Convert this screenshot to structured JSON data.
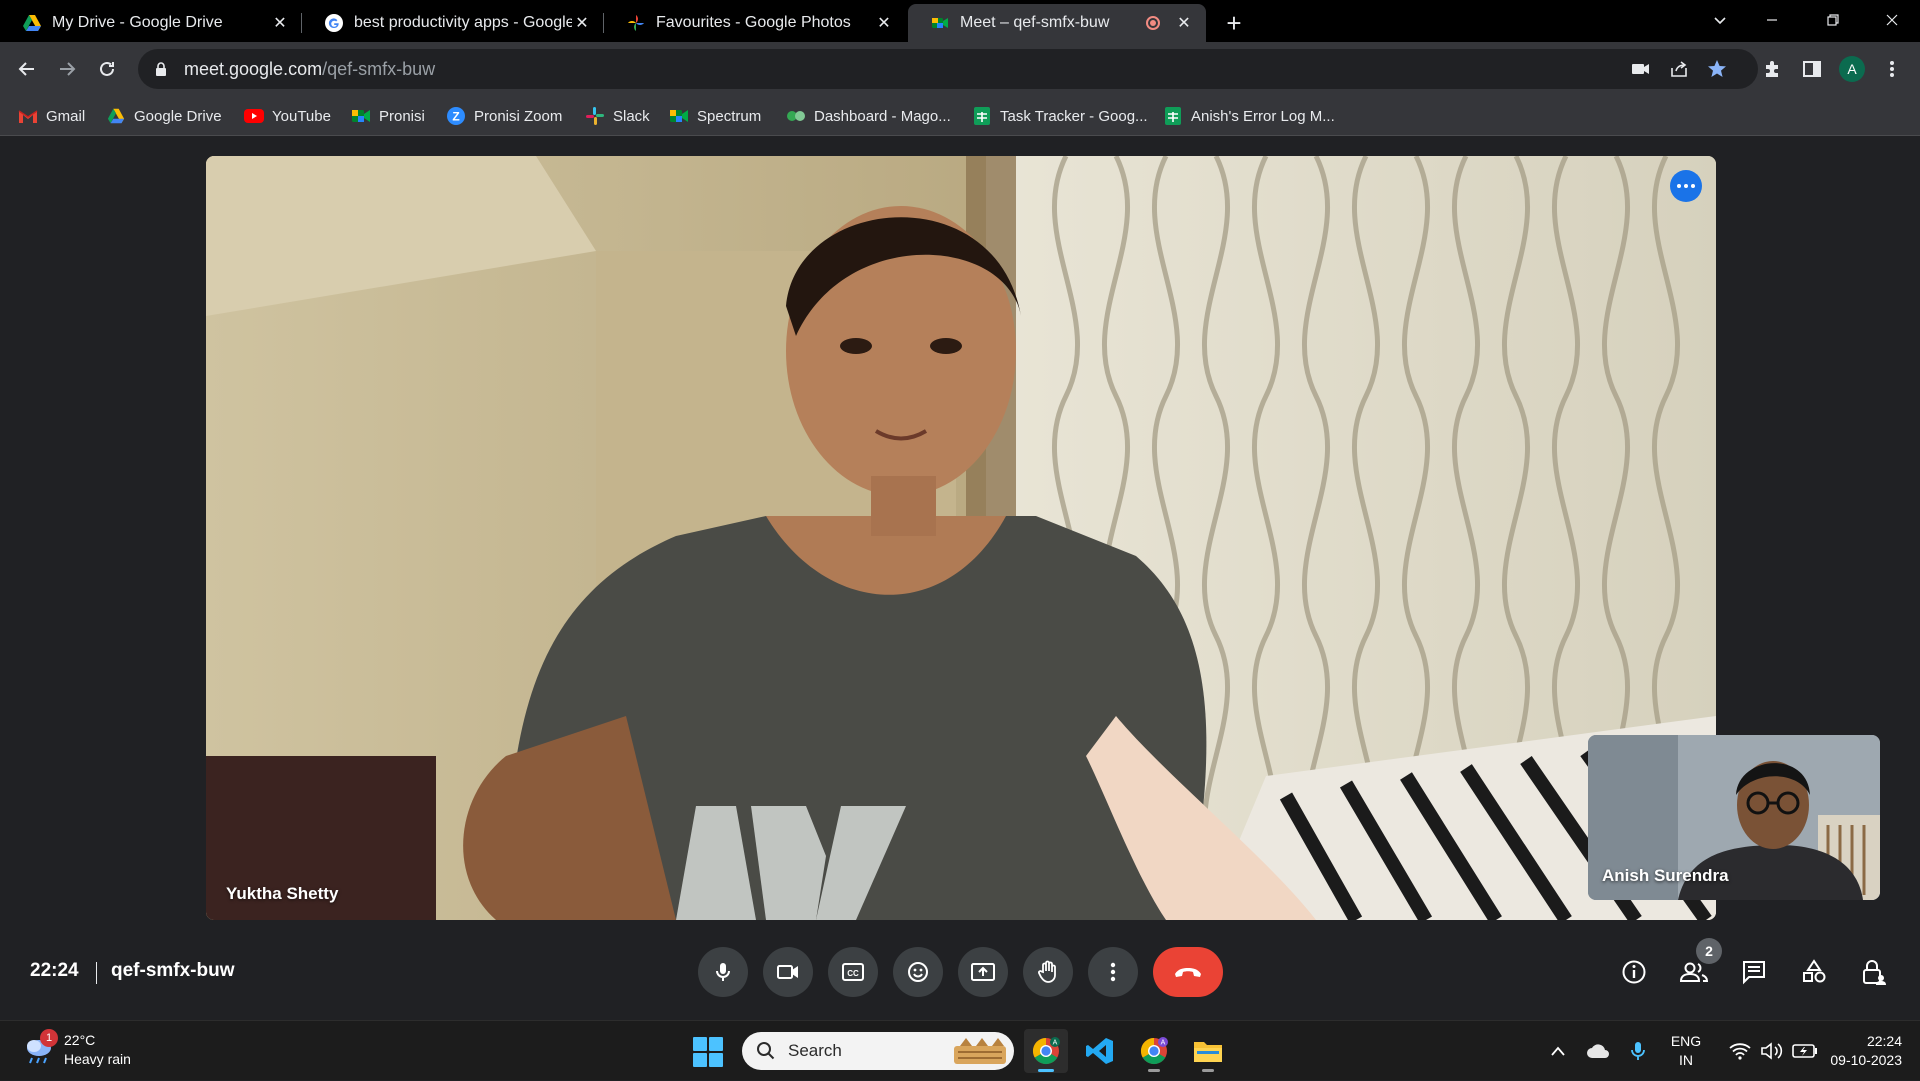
{
  "browser": {
    "tabs": [
      {
        "title": "My Drive - Google Drive",
        "icon": "google-drive-icon"
      },
      {
        "title": "best productivity apps - Google",
        "icon": "google-icon"
      },
      {
        "title": "Favourites - Google Photos",
        "icon": "google-photos-icon"
      },
      {
        "title": "Meet – qef-smfx-buw",
        "icon": "google-meet-icon",
        "active": true,
        "recording": true
      }
    ],
    "url_host": "meet.google.com",
    "url_path": "/qef-smfx-buw",
    "profile_initial": "A",
    "bookmarks": [
      {
        "label": "Gmail",
        "icon": "gmail-icon"
      },
      {
        "label": "Google Drive",
        "icon": "google-drive-icon"
      },
      {
        "label": "YouTube",
        "icon": "youtube-icon"
      },
      {
        "label": "Pronisi",
        "icon": "google-meet-icon"
      },
      {
        "label": "Pronisi Zoom",
        "icon": "zoom-icon"
      },
      {
        "label": "Slack",
        "icon": "slack-icon"
      },
      {
        "label": "Spectrum",
        "icon": "google-meet-icon"
      },
      {
        "label": "Dashboard - Mago...",
        "icon": "dashboard-icon"
      },
      {
        "label": "Task Tracker - Goog...",
        "icon": "google-sheets-icon"
      },
      {
        "label": "Anish's Error Log M...",
        "icon": "google-sheets-icon"
      }
    ]
  },
  "meet": {
    "main_participant": "Yuktha Shetty",
    "self_participant": "Anish Surendra",
    "time": "22:24",
    "meeting_code": "qef-smfx-buw",
    "participant_count": "2",
    "controls": [
      "microphone",
      "camera",
      "captions",
      "reactions",
      "present-screen",
      "raise-hand",
      "more-options",
      "end-call"
    ],
    "side_controls": [
      "meeting-details",
      "people",
      "chat",
      "activities",
      "host-controls"
    ],
    "colors": {
      "end_call": "#ea4335",
      "accent": "#1a73e8",
      "control_bg": "#3c4043"
    }
  },
  "taskbar": {
    "weather_temp": "22°C",
    "weather_desc": "Heavy rain",
    "weather_badge": "1",
    "search_label": "Search",
    "lang_top": "ENG",
    "lang_bottom": "IN",
    "time": "22:24",
    "date": "09-10-2023"
  }
}
